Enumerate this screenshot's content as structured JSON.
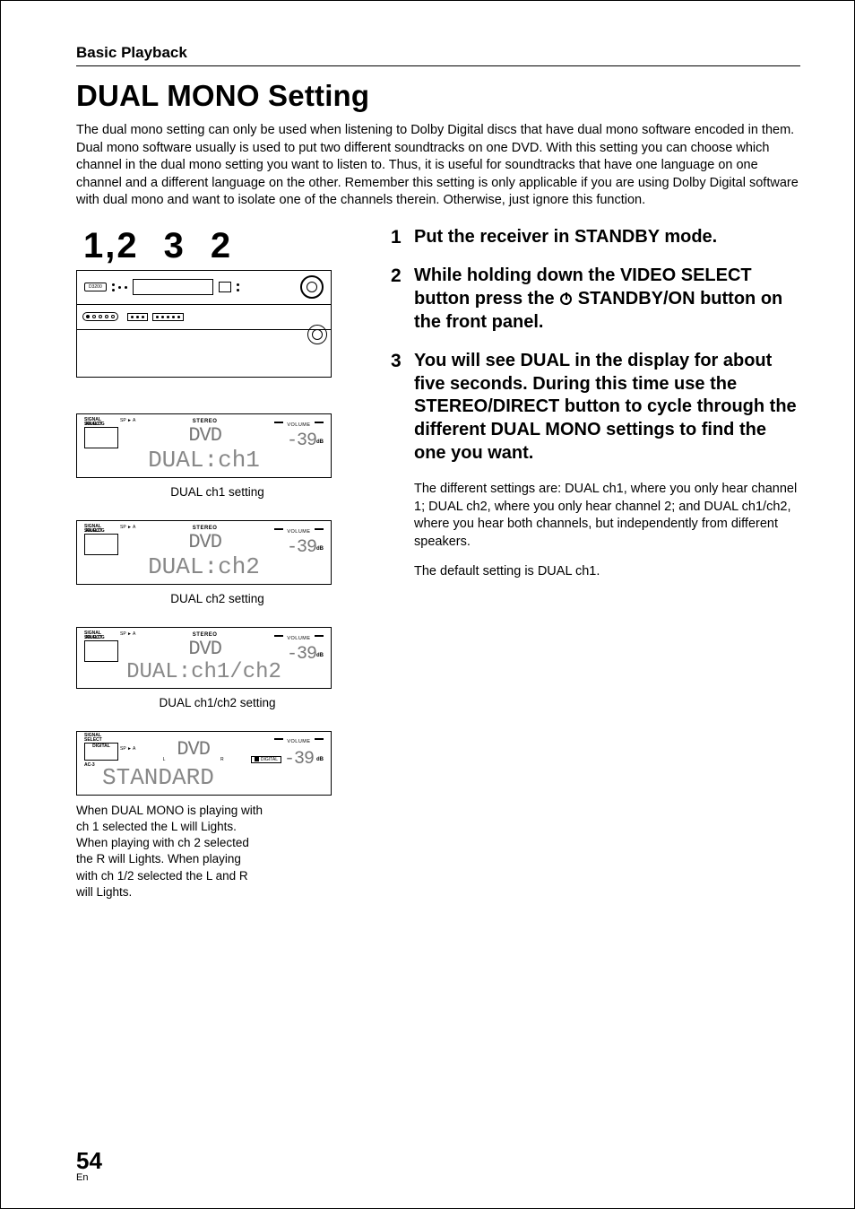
{
  "section_label": "Basic Playback",
  "title": "DUAL MONO Setting",
  "intro": "The dual mono setting can only be used when listening to Dolby Digital discs that have dual mono software encoded in them. Dual mono software usually is used to put two different soundtracks on one DVD. With this setting you can choose which channel in the dual mono setting you want to listen to. Thus, it is useful for soundtracks that have one language on one channel and a different language on the other. Remember this setting is only applicable if you are using Dolby Digital software with dual mono and want to isolate one of the channels therein. Otherwise, just ignore this function.",
  "big_nums": {
    "a": "1,2",
    "b": "3",
    "c": "2"
  },
  "receiver": {
    "brand": "D3200"
  },
  "lcd": {
    "signal_select": "SIGNAL\nSELECT",
    "analog": "ANALOG",
    "digital": "DIGITAL",
    "ac3": "AC-3",
    "sp_a": "SP ► A",
    "stereo": "STEREO",
    "volume": "VOLUME",
    "dvd": "DVD",
    "db_value": "-39",
    "db": "dB",
    "dd": "DIGITAL",
    "L": "L",
    "R": "R"
  },
  "panels": [
    {
      "line2": "DUAL:ch1",
      "caption": "DUAL ch1 setting"
    },
    {
      "line2": "DUAL:ch2",
      "caption": "DUAL ch2 setting"
    },
    {
      "line2": "DUAL:ch1/ch2",
      "caption": "DUAL ch1/ch2 setting"
    }
  ],
  "standard_line": "STANDARD",
  "standard_caption": "When DUAL MONO is playing with ch 1 selected the L will Lights. When playing with ch 2 selected the R will Lights. When playing with ch 1/2 selected the L and R will Lights.",
  "steps": [
    {
      "num": "1",
      "head": "Put the receiver in STANDBY mode."
    },
    {
      "num": "2",
      "head_parts": {
        "a": "While holding down the VIDEO SELECT button press the ",
        "b": " STANDBY/ON button on the front panel."
      }
    },
    {
      "num": "3",
      "head": "You will see DUAL in the display for about five seconds. During this time use the STEREO/DIRECT button to cycle through the different DUAL MONO settings to find the one you want."
    }
  ],
  "step3_body1": "The different settings are: DUAL ch1, where you only hear channel 1; DUAL ch2, where you only hear channel 2; and DUAL ch1/ch2, where you hear both channels, but independently from different speakers.",
  "step3_body2": "The default setting is DUAL ch1.",
  "page_num": "54",
  "lang": "En"
}
